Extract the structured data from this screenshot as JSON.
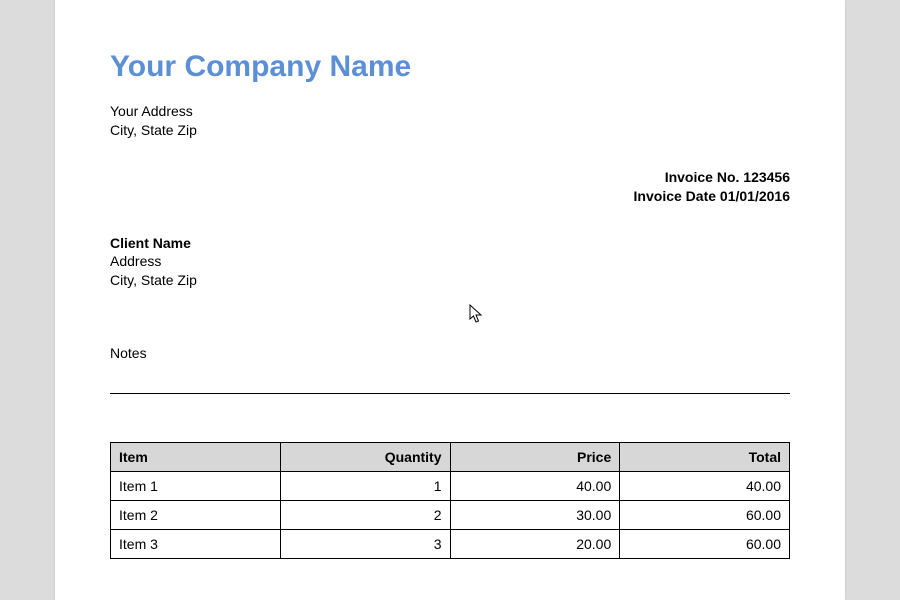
{
  "company": {
    "name": "Your Company Name",
    "address_line1": "Your Address",
    "address_line2": "City, State Zip"
  },
  "invoice": {
    "number_label": "Invoice No.",
    "number": "123456",
    "date_label": "Invoice Date",
    "date": "01/01/2016"
  },
  "client": {
    "name": "Client Name",
    "address_line1": "Address",
    "address_line2": "City, State Zip"
  },
  "notes": {
    "label": "Notes"
  },
  "table": {
    "headers": {
      "item": "Item",
      "quantity": "Quantity",
      "price": "Price",
      "total": "Total"
    },
    "rows": [
      {
        "item": "Item 1",
        "quantity": "1",
        "price": "40.00",
        "total": "40.00"
      },
      {
        "item": "Item 2",
        "quantity": "2",
        "price": "30.00",
        "total": "60.00"
      },
      {
        "item": "Item 3",
        "quantity": "3",
        "price": "20.00",
        "total": "60.00"
      }
    ]
  }
}
